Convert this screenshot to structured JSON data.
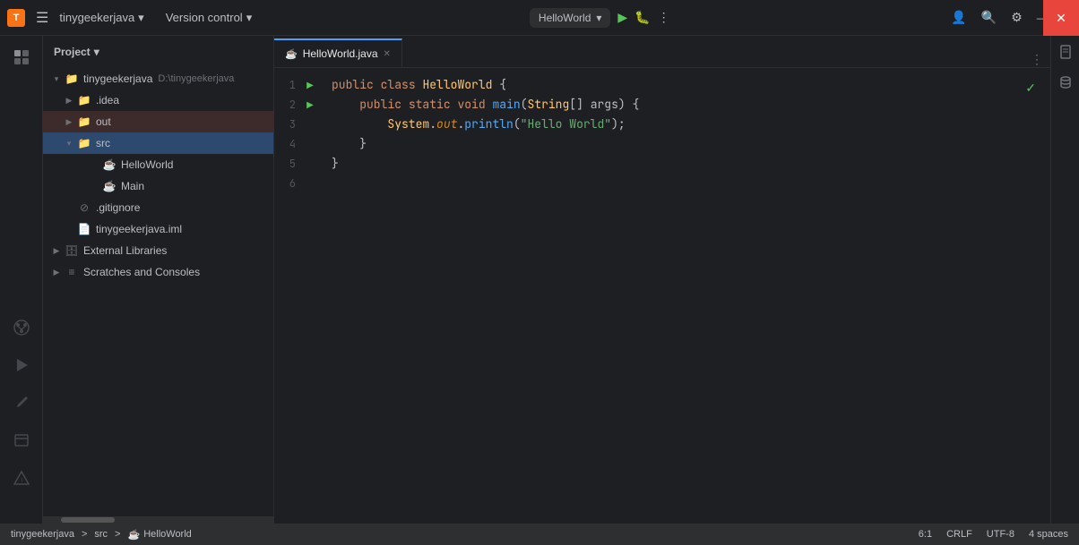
{
  "titlebar": {
    "icon_label": "T",
    "project_name": "tinygeekerjava",
    "project_arrow": "▾",
    "version_control": "Version control",
    "version_arrow": "▾",
    "run_config": "HelloWorld",
    "run_config_arrow": "▾",
    "close_label": "✕",
    "minimize_label": "—",
    "maximize_label": "□"
  },
  "sidebar": {
    "project_label": "Project",
    "project_arrow": "▾"
  },
  "tree": {
    "root": "tinygeekerjava",
    "root_path": "D:\\tinygeekerjava",
    "idea": ".idea",
    "out": "out",
    "src": "src",
    "hello_world": "HelloWorld",
    "main": "Main",
    "gitignore": ".gitignore",
    "iml": "tinygeekerjava.iml",
    "ext_libs": "External Libraries",
    "scratches": "Scratches and Consoles"
  },
  "tab": {
    "filename": "HelloWorld.java",
    "close": "✕"
  },
  "code": {
    "line1": "public class HelloWorld {",
    "line2": "    public static void main(String[] args) {",
    "line3": "        System.out.println(\"Hello World\");",
    "line4": "    }",
    "line5": "}",
    "line6": ""
  },
  "statusbar": {
    "breadcrumb1": "tinygeekerjava",
    "sep1": ">",
    "breadcrumb2": "src",
    "sep2": ">",
    "breadcrumb3": "HelloWorld",
    "cursor": "6:1",
    "line_ending": "CRLF",
    "encoding": "UTF-8",
    "indent": "4 spaces"
  }
}
